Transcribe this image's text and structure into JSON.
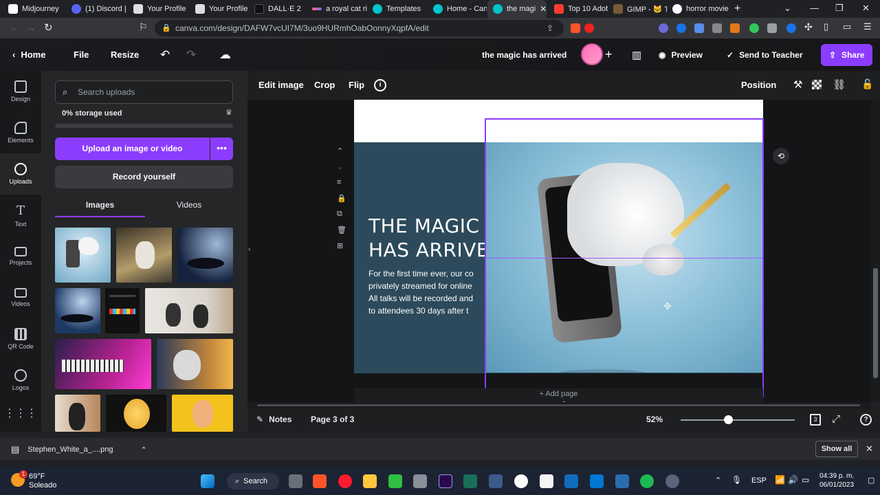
{
  "browser": {
    "tabs": [
      {
        "label": "Midjourney",
        "color": "#ffffff"
      },
      {
        "label": "(1) Discord |",
        "color": "#5865f2"
      },
      {
        "label": "Your Profile",
        "color": "#dddddd"
      },
      {
        "label": "Your Profile",
        "color": "#dddddd"
      },
      {
        "label": "DALL·E 2",
        "color": "#111111"
      },
      {
        "label": "a royal cat ri",
        "color": "#7b61ff"
      },
      {
        "label": "Templates",
        "color": "#00c4cc"
      },
      {
        "label": "Home - Canv",
        "color": "#00c4cc"
      },
      {
        "label": "the magi",
        "color": "#00c4cc",
        "active": true
      },
      {
        "label": "Top 10 Adob",
        "color": "#ff3b30"
      },
      {
        "label": "GIMP - 🐱 T",
        "color": "#7a5b36"
      },
      {
        "label": "horror movie",
        "color": "#ffffff"
      }
    ],
    "url": "canva.com/design/DAFW7vcUI7M/3uo9HURmhOabOonnyXqpfA/edit"
  },
  "header": {
    "home": "Home",
    "file": "File",
    "resize": "Resize",
    "design_title": "the magic has arrived",
    "preview": "Preview",
    "send_to_teacher": "Send to Teacher",
    "share": "Share"
  },
  "rail": {
    "items": [
      "Design",
      "Elements",
      "Uploads",
      "Text",
      "Projects",
      "Videos",
      "QR Code",
      "Logos"
    ]
  },
  "panel": {
    "search_placeholder": "Search uploads",
    "storage": "0% storage used",
    "upload_button": "Upload an image or video",
    "more": "•••",
    "record": "Record yourself",
    "tabs": [
      "Images",
      "Videos"
    ]
  },
  "toolbar": {
    "edit_image": "Edit image",
    "crop": "Crop",
    "flip": "Flip",
    "info": "i",
    "position": "Position"
  },
  "canvas": {
    "headline_line1": "THE MAGIC",
    "headline_line2": "HAS ARRIVE",
    "body_lines": [
      "For the first time ever, our co",
      "privately streamed for online",
      "All talks will be recorded and",
      "to attendees 30 days after t"
    ],
    "add_page": "+ Add page"
  },
  "bottom": {
    "notes": "Notes",
    "page": "Page 3 of 3",
    "zoom": "52%",
    "zoom_level": 0.52,
    "pages_badge": "3",
    "help": "?"
  },
  "download": {
    "file": "Stephen_White_a_....png",
    "show_all": "Show all"
  },
  "taskbar": {
    "weather_temp": "69°F",
    "weather_desc": "Soleado",
    "weather_badge": "1",
    "search": "Search",
    "language": "ESP",
    "time": "04:39 p. m.",
    "date": "06/01/2023"
  },
  "colors": {
    "accent": "#8b3dff",
    "canvas_bg": "#2c4a5b"
  }
}
